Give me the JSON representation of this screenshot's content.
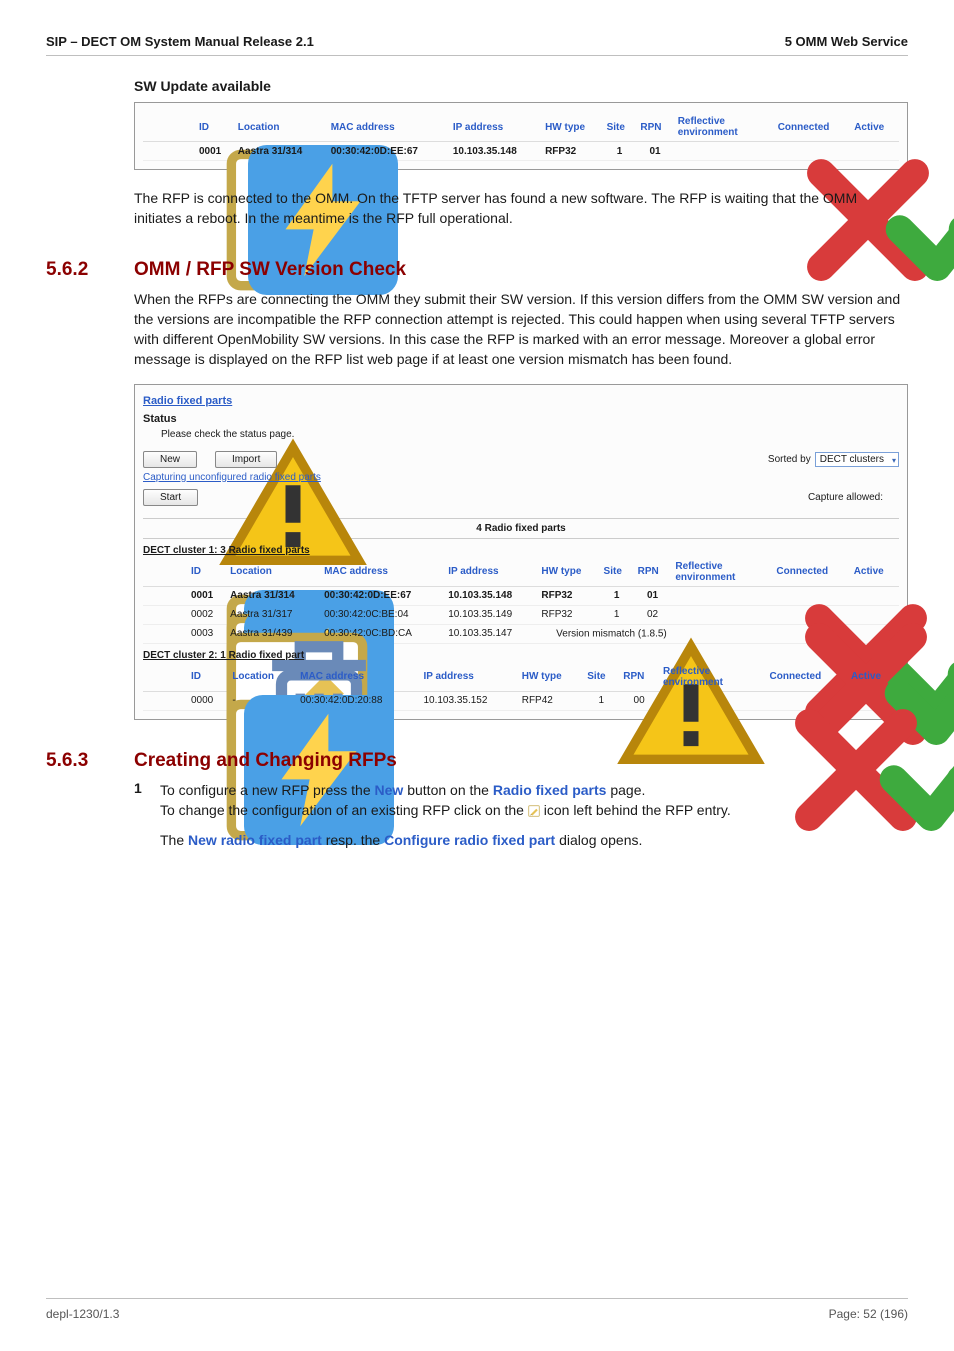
{
  "header": {
    "left": "SIP – DECT OM System Manual Release 2.1",
    "right": "5 OMM Web Service"
  },
  "subhead": "SW Update available",
  "panel1": {
    "headers": [
      "ID",
      "Location",
      "MAC address",
      "IP address",
      "HW type",
      "Site",
      "RPN",
      "Reflective environment",
      "Connected",
      "Active"
    ],
    "row": {
      "id": "0001",
      "location": "Aastra 31/314",
      "mac": "00:30:42:0D:EE:67",
      "ip": "10.103.35.148",
      "hw": "RFP32",
      "site": "1",
      "rpn": "01"
    }
  },
  "p1": "The RFP is connected to the OMM. On the TFTP server has found a new software. The RFP is waiting that the OMM initiates a reboot. In the meantime is the RFP full operational.",
  "sec_562": {
    "num": "5.6.2",
    "title": "OMM / RFP SW Version Check",
    "body": "When the RFPs are connecting the OMM they submit their SW version. If this version differs from the OMM SW version and the versions are incompatible the RFP connection attempt is rejected. This could happen when using several TFTP servers with different OpenMobility SW versions. In this case the RFP is marked with an error message. Moreover a global error message is displayed on the RFP list web page if at least one version mismatch has been found."
  },
  "panel2": {
    "title": "Radio fixed parts",
    "status_label": "Status",
    "status_msg": "Please check the status page.",
    "btn_new": "New",
    "btn_import": "Import",
    "capturing_link": "Capturing unconfigured radio fixed parts",
    "btn_start": "Start",
    "sorted_by_label": "Sorted by",
    "sorted_by_value": "DECT clusters",
    "capture_allowed": "Capture allowed:",
    "mid_title": "4 Radio fixed parts",
    "cluster1_title": "DECT cluster 1: 3 Radio fixed parts",
    "headers": [
      "ID",
      "Location",
      "MAC address",
      "IP address",
      "HW type",
      "Site",
      "RPN",
      "Reflective environment",
      "Connected",
      "Active"
    ],
    "cluster1_rows": [
      {
        "id": "0001",
        "location": "Aastra 31/314",
        "mac": "00:30:42:0D:EE:67",
        "ip": "10.103.35.148",
        "hw": "RFP32",
        "site": "1",
        "rpn": "01",
        "mismatch": false,
        "bold": true
      },
      {
        "id": "0002",
        "location": "Aastra 31/317",
        "mac": "00:30:42:0C:BE:04",
        "ip": "10.103.35.149",
        "hw": "RFP32",
        "site": "1",
        "rpn": "02",
        "mismatch": false,
        "bold": false
      },
      {
        "id": "0003",
        "location": "Aastra 31/439",
        "mac": "00:30:42:0C:BD:CA",
        "ip": "10.103.35.147",
        "hw": "",
        "site": "",
        "rpn": "",
        "mismatch": true,
        "bold": false
      }
    ],
    "mismatch_text": "Version mismatch (1.8.5)",
    "cluster2_title": "DECT cluster 2: 1 Radio fixed part",
    "cluster2_rows": [
      {
        "id": "0000",
        "location": "-",
        "mac": "00:30:42:0D:20:88",
        "ip": "10.103.35.152",
        "hw": "RFP42",
        "site": "1",
        "rpn": "00",
        "bold": false
      }
    ]
  },
  "sec_563": {
    "num": "5.6.3",
    "title": "Creating and Changing RFPs",
    "step1_a": "To configure a new RFP press the ",
    "step1_new": "New",
    "step1_b": " button on the ",
    "step1_rfp": "Radio fixed parts",
    "step1_c": " page.",
    "step2_a": "To change the configuration of an existing RFP click on the ",
    "step2_b": " icon left behind the RFP entry.",
    "step3_a": "The ",
    "step3_new": "New radio fixed part",
    "step3_b": " resp. the ",
    "step3_conf": "Configure radio fixed part",
    "step3_c": " dialog opens."
  },
  "footer": {
    "left": "depl-1230/1.3",
    "right": "Page: 52 (196)"
  }
}
